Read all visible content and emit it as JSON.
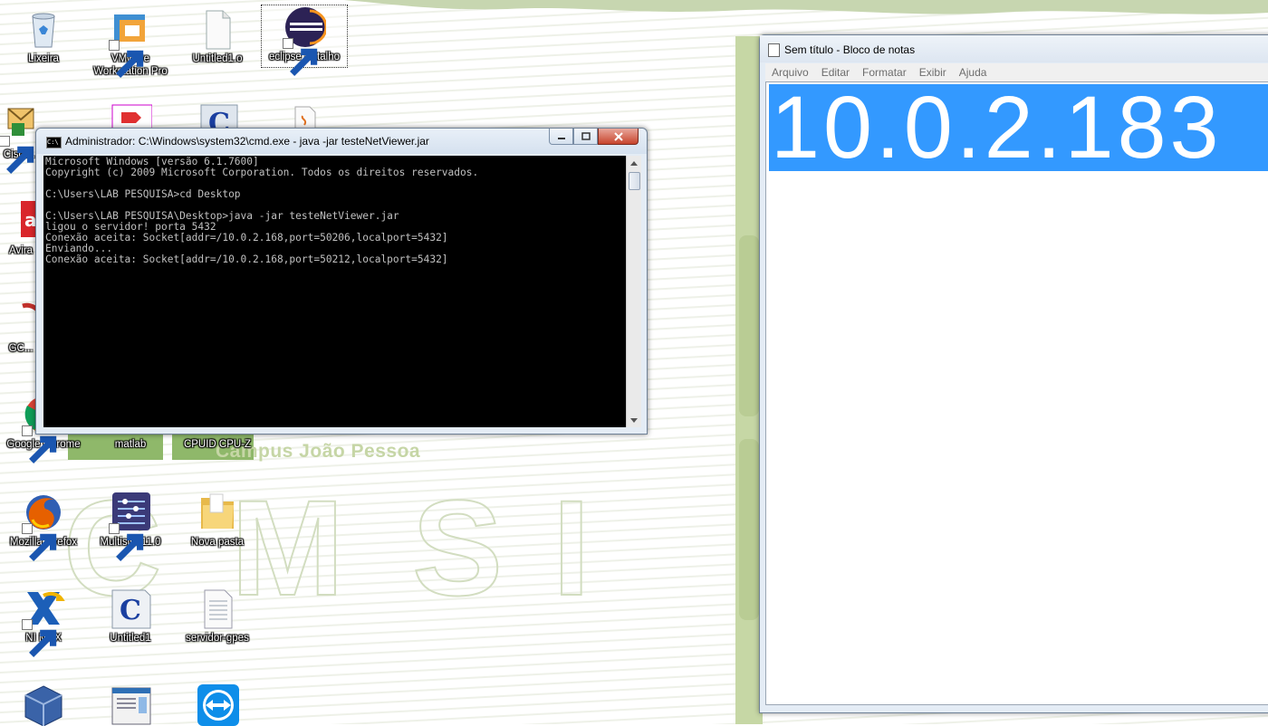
{
  "wallpaper": {
    "campus_text": "Campus João Pessoa",
    "letters": [
      "C",
      "M",
      "S",
      "I"
    ]
  },
  "desktop": {
    "icons": [
      {
        "label": "Lixeira",
        "icon": "recycle-bin-icon"
      },
      {
        "label": "VMware Workstation Pro",
        "icon": "vmware-icon"
      },
      {
        "label": "Untitled1.o",
        "icon": "blank-file-icon"
      },
      {
        "label": "eclipse - Atalho",
        "icon": "eclipse-icon"
      },
      {
        "label": "Cisco...",
        "icon": "cisco-icon"
      },
      {
        "label": "Avira",
        "icon": "avira-icon"
      },
      {
        "label": "GC...",
        "icon": "gc-icon"
      },
      {
        "label": "Google Chrome",
        "icon": "chrome-icon"
      },
      {
        "label": "matlab",
        "icon": "matlab-icon"
      },
      {
        "label": "CPUID CPU-Z",
        "icon": "cpuz-icon"
      },
      {
        "label": "Mozilla Firefox",
        "icon": "firefox-icon"
      },
      {
        "label": "Multisim 11.0",
        "icon": "multisim-icon"
      },
      {
        "label": "Nova pasta",
        "icon": "folder-icon"
      },
      {
        "label": "NI MAX",
        "icon": "nimax-icon"
      },
      {
        "label": "Untitled1",
        "icon": "c-source-icon"
      },
      {
        "label": "servidor-gpes",
        "icon": "text-file-icon"
      }
    ]
  },
  "cmd_window": {
    "title": "Administrador: C:\\Windows\\system32\\cmd.exe - java  -jar testeNetViewer.jar",
    "lines": [
      "Microsoft Windows [versão 6.1.7600]",
      "Copyright (c) 2009 Microsoft Corporation. Todos os direitos reservados.",
      "",
      "C:\\Users\\LAB PESQUISA>cd Desktop",
      "",
      "C:\\Users\\LAB PESQUISA\\Desktop>java -jar testeNetViewer.jar",
      "ligou o servidor! porta 5432",
      "Conexão aceita: Socket[addr=/10.0.2.168,port=50206,localport=5432]",
      "Enviando...",
      "Conexão aceita: Socket[addr=/10.0.2.168,port=50212,localport=5432]"
    ]
  },
  "notepad_window": {
    "title": "Sem título - Bloco de notas",
    "menu": [
      "Arquivo",
      "Editar",
      "Formatar",
      "Exibir",
      "Ajuda"
    ],
    "content": "10.0.2.183"
  },
  "colors": {
    "selection": "#3399ff",
    "console_bg": "#000000",
    "console_fg": "#c0c0c0"
  }
}
